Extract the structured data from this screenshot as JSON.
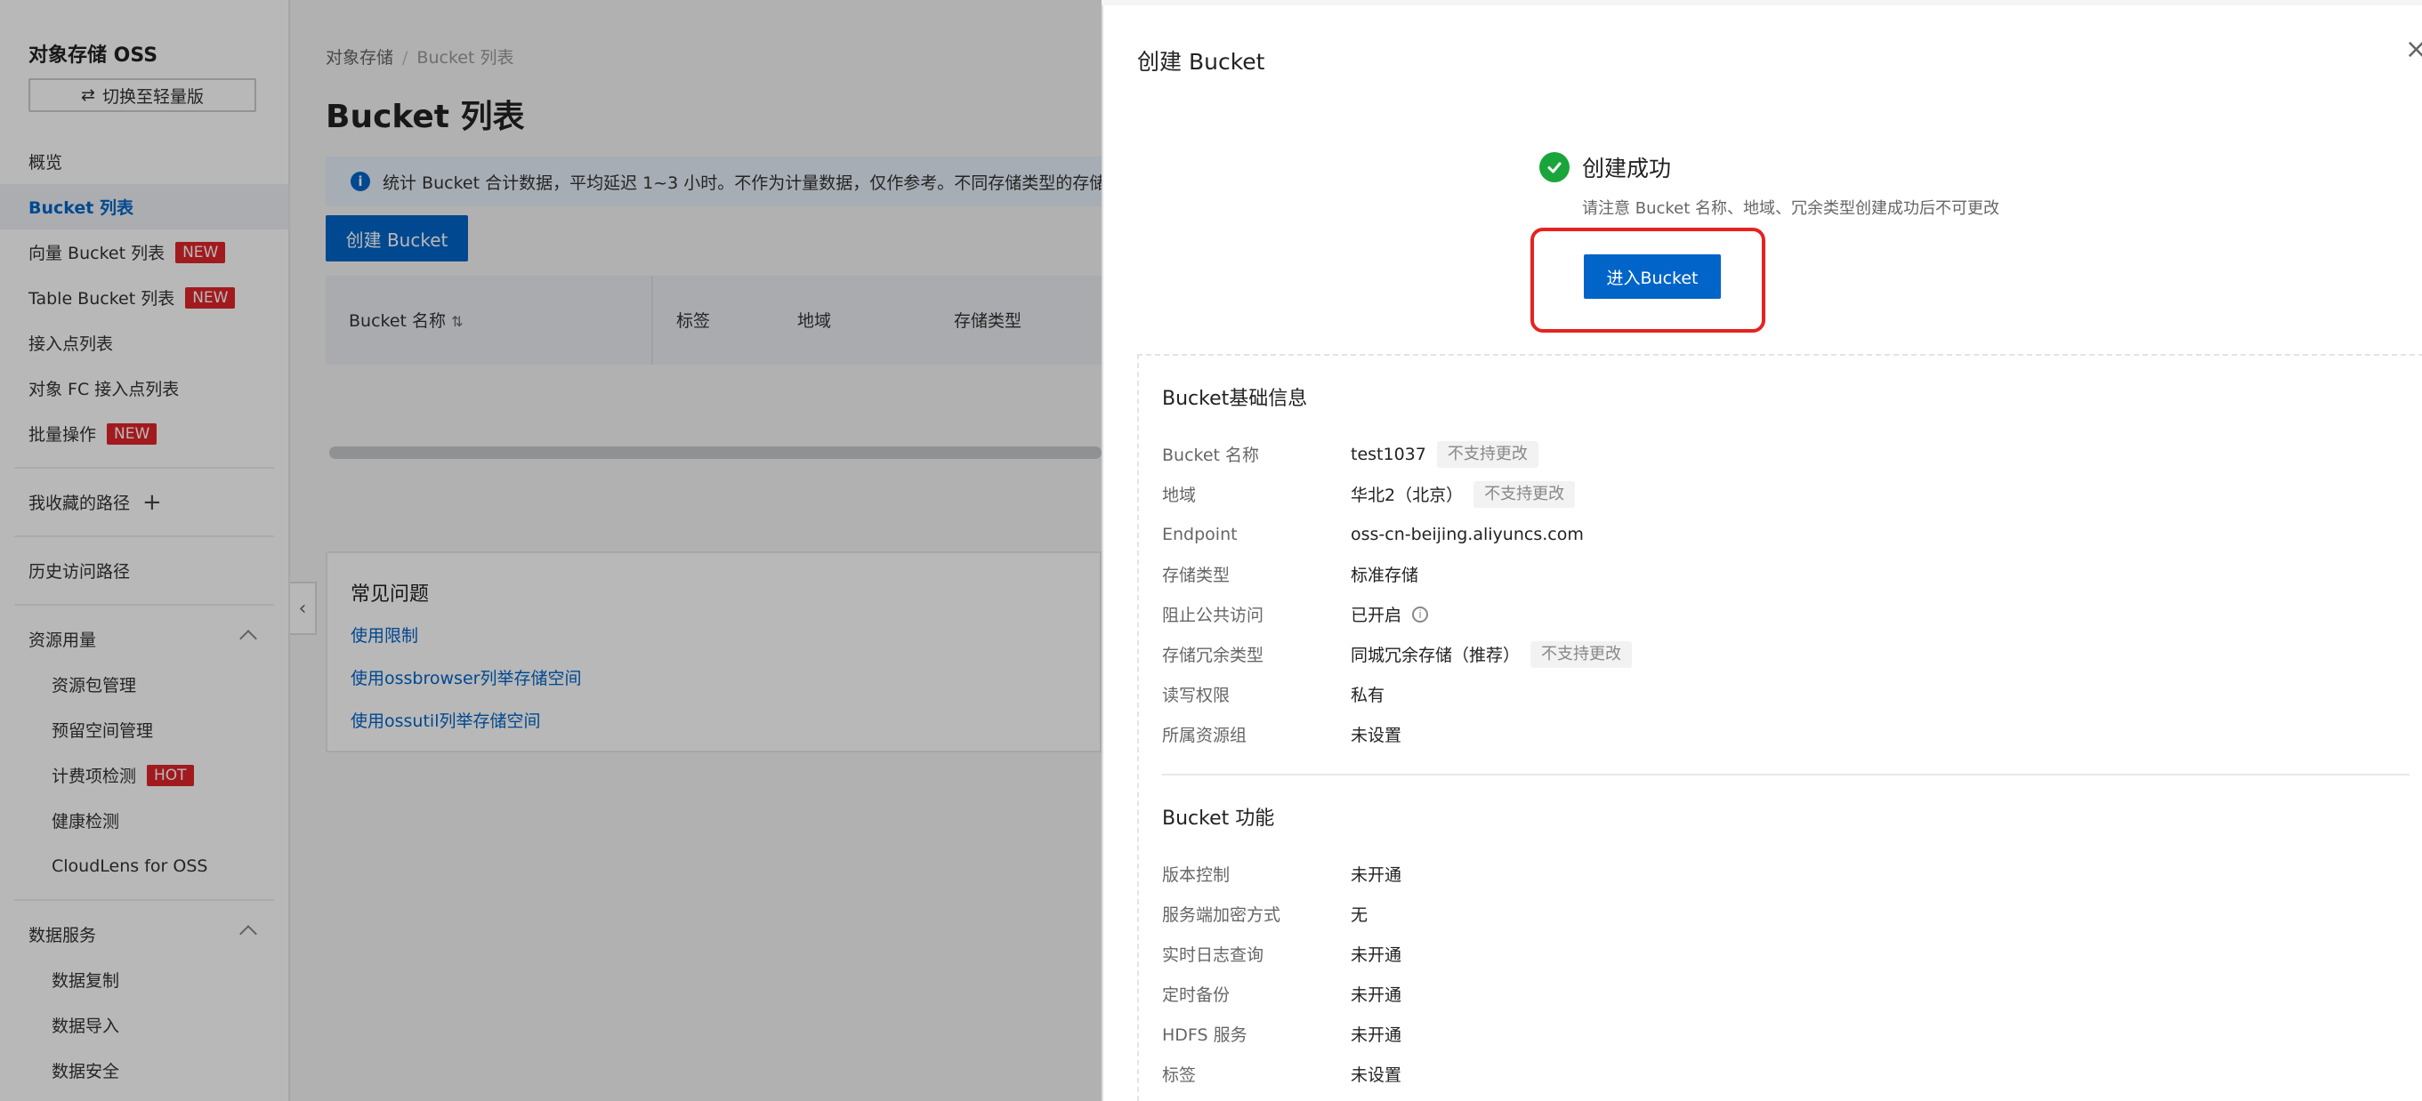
{
  "sidebar": {
    "title": "对象存储 OSS",
    "switch_label": "切换至轻量版",
    "items": [
      {
        "label": "概览"
      },
      {
        "label": "Bucket 列表"
      },
      {
        "label": "向量 Bucket 列表",
        "badge": "NEW"
      },
      {
        "label": "Table Bucket 列表",
        "badge": "NEW"
      },
      {
        "label": "接入点列表"
      },
      {
        "label": "对象 FC 接入点列表"
      },
      {
        "label": "批量操作",
        "badge": "NEW"
      }
    ],
    "favorites": "我收藏的路径",
    "history": "历史访问路径",
    "resource_group": {
      "label": "资源用量",
      "children": [
        {
          "label": "资源包管理"
        },
        {
          "label": "预留空间管理"
        },
        {
          "label": "计费项检测",
          "badge": "HOT"
        },
        {
          "label": "健康检测"
        },
        {
          "label": "CloudLens for OSS"
        }
      ]
    },
    "data_group": {
      "label": "数据服务",
      "children": [
        {
          "label": "数据复制"
        },
        {
          "label": "数据导入"
        },
        {
          "label": "数据安全"
        }
      ]
    }
  },
  "main": {
    "breadcrumb": [
      "对象存储",
      "Bucket 列表"
    ],
    "title": "Bucket 列表",
    "notice": "统计 Bucket 合计数据，平均延迟 1~3 小时。不作为计量数据，仅作参考。不同存储类型的存储",
    "create_button": "创建 Bucket",
    "columns": [
      "Bucket 名称",
      "标签",
      "地域",
      "存储类型"
    ],
    "faq": {
      "title": "常见问题",
      "links": [
        "使用限制",
        "使用ossbrowser列举存储空间",
        "使用ossutil列举存储空间"
      ]
    }
  },
  "drawer": {
    "title": "创建 Bucket",
    "success_title": "创建成功",
    "success_sub": "请注意 Bucket 名称、地域、冗余类型创建成功后不可更改",
    "enter_button": "进入Bucket",
    "basic": {
      "title": "Bucket基础信息",
      "rows": [
        {
          "k": "Bucket 名称",
          "v": "test1037",
          "tag": "不支持更改"
        },
        {
          "k": "地域",
          "v": "华北2（北京）",
          "tag": "不支持更改"
        },
        {
          "k": "Endpoint",
          "v": "oss-cn-beijing.aliyuncs.com"
        },
        {
          "k": "存储类型",
          "v": "标准存储"
        },
        {
          "k": "阻止公共访问",
          "v": "已开启"
        },
        {
          "k": "存储冗余类型",
          "v": "同城冗余存储（推荐）",
          "tag": "不支持更改"
        },
        {
          "k": "读写权限",
          "v": "私有"
        },
        {
          "k": "所属资源组",
          "v": "未设置"
        }
      ]
    },
    "features": {
      "title": "Bucket 功能",
      "rows": [
        {
          "k": "版本控制",
          "v": "未开通"
        },
        {
          "k": "服务端加密方式",
          "v": "无"
        },
        {
          "k": "实时日志查询",
          "v": "未开通"
        },
        {
          "k": "定时备份",
          "v": "未开通"
        },
        {
          "k": "HDFS 服务",
          "v": "未开通"
        },
        {
          "k": "标签",
          "v": "未设置"
        }
      ]
    }
  },
  "colors": {
    "primary": "#0064c8",
    "badge": "#e0242a",
    "success": "#1aa53c",
    "highlight": "#e62222"
  }
}
